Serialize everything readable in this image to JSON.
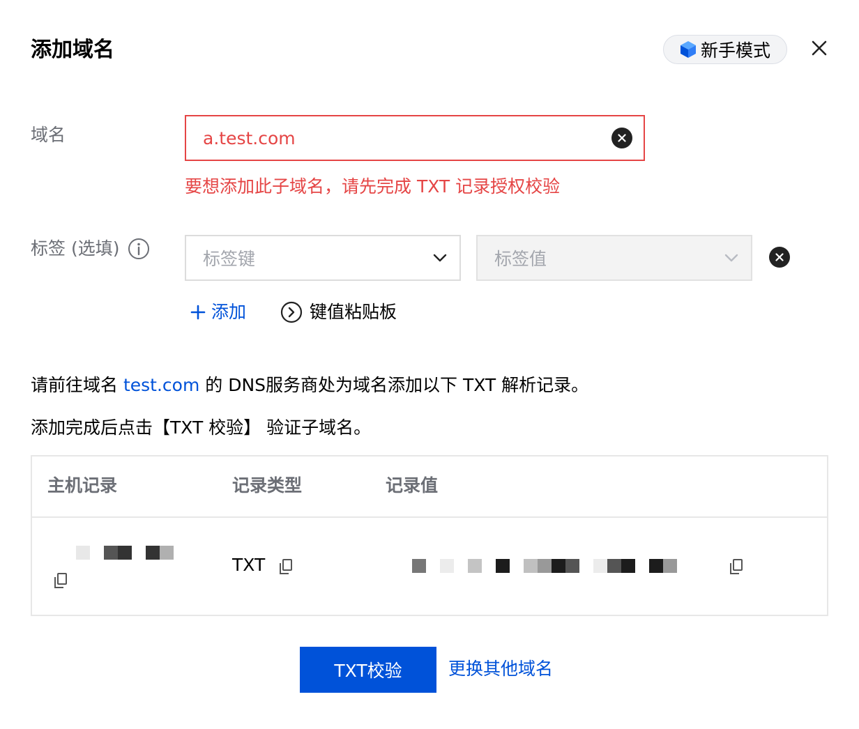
{
  "dialog": {
    "title": "添加域名",
    "guide_button": "新手模式"
  },
  "form": {
    "domain": {
      "label": "域名",
      "value": "a.test.com",
      "error": "要想添加此子域名，请先完成 TXT 记录授权校验"
    },
    "tags": {
      "label": "标签 (选填)",
      "key_placeholder": "标签键",
      "value_placeholder": "标签值",
      "add_label": "添加",
      "paste_label": "键值粘贴板"
    }
  },
  "instructions": {
    "line1_prefix": "请前往域名 ",
    "line1_link": "test.com",
    "line1_suffix": " 的 DNS服务商处为域名添加以下 TXT 解析记录。",
    "line2": "添加完成后点击【TXT 校验】 验证子域名。"
  },
  "table": {
    "headers": [
      "主机记录",
      "记录类型",
      "记录值"
    ],
    "row": {
      "host": "",
      "type": "TXT",
      "value": ""
    }
  },
  "actions": {
    "verify_button": "TXT校验",
    "change_link": "更换其他域名"
  },
  "colors": {
    "primary": "#0052d9",
    "error": "#e54545"
  }
}
